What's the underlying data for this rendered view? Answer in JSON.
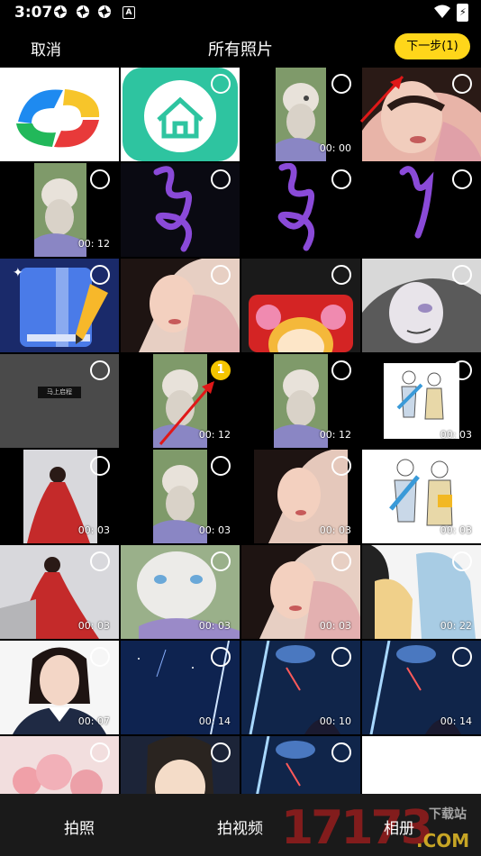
{
  "status_bar": {
    "time": "3:07",
    "a_badge": "A"
  },
  "header": {
    "cancel": "取消",
    "title": "所有照片",
    "next": "下一步(1)"
  },
  "grid": {
    "cells": [
      {
        "dur": "",
        "sel": ""
      },
      {
        "dur": "",
        "sel": ""
      },
      {
        "dur": "00: 00",
        "sel": ""
      },
      {
        "dur": "",
        "sel": ""
      },
      {
        "dur": "00: 12",
        "sel": ""
      },
      {
        "dur": "",
        "sel": ""
      },
      {
        "dur": "",
        "sel": ""
      },
      {
        "dur": "",
        "sel": ""
      },
      {
        "dur": "",
        "sel": ""
      },
      {
        "dur": "",
        "sel": ""
      },
      {
        "dur": "",
        "sel": ""
      },
      {
        "dur": "",
        "sel": ""
      },
      {
        "dur": "",
        "sel": "",
        "text": "马上启程"
      },
      {
        "dur": "00: 12",
        "sel": "1"
      },
      {
        "dur": "00: 12",
        "sel": ""
      },
      {
        "dur": "00: 03",
        "sel": ""
      },
      {
        "dur": "00: 03",
        "sel": ""
      },
      {
        "dur": "00: 03",
        "sel": ""
      },
      {
        "dur": "00: 03",
        "sel": ""
      },
      {
        "dur": "00: 03",
        "sel": ""
      },
      {
        "dur": "00: 03",
        "sel": ""
      },
      {
        "dur": "00: 03",
        "sel": ""
      },
      {
        "dur": "00: 03",
        "sel": ""
      },
      {
        "dur": "00: 22",
        "sel": ""
      },
      {
        "dur": "00: 07",
        "sel": ""
      },
      {
        "dur": "00: 14",
        "sel": ""
      },
      {
        "dur": "00: 10",
        "sel": ""
      },
      {
        "dur": "00: 14",
        "sel": ""
      },
      {
        "dur": "",
        "sel": ""
      },
      {
        "dur": "",
        "sel": ""
      },
      {
        "dur": "",
        "sel": ""
      },
      {
        "dur": "",
        "sel": ""
      }
    ]
  },
  "bottom_bar": {
    "photo": "拍照",
    "video": "拍视频",
    "album": "相册",
    "watermark_num": "17173",
    "watermark_site": "下载站",
    "watermark_com": ".COM"
  },
  "colors": {
    "accent": "#ffd61a",
    "background": "#000000"
  }
}
